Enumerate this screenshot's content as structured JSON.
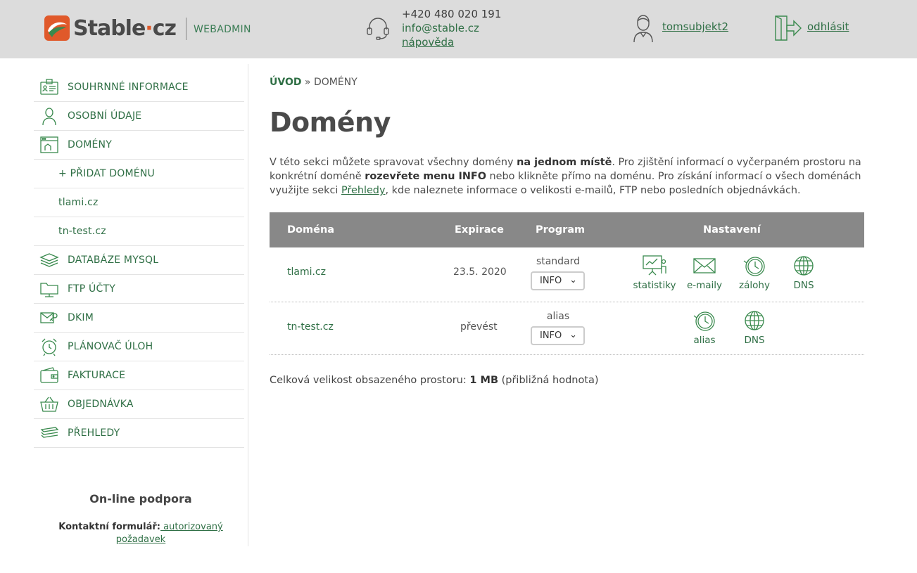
{
  "header": {
    "brand": "Stable",
    "brand_dot": "·",
    "brand_tld": "cz",
    "webadmin": "WEBADMIN",
    "phone": "+420 480 020 191",
    "email": "info@stable.cz",
    "help": "nápověda",
    "username": "tomsubjekt2",
    "logout": "odhlásit"
  },
  "sidebar": {
    "items": [
      {
        "label": "SOUHRNNÉ INFORMACE",
        "icon": "id-card-icon"
      },
      {
        "label": "OSOBNÍ ÚDAJE",
        "icon": "person-icon"
      },
      {
        "label": "DOMÉNY",
        "icon": "browser-window-icon"
      },
      {
        "label": "+ PŘIDAT DOMÉNU"
      },
      {
        "label": "tlami.cz"
      },
      {
        "label": "tn-test.cz"
      },
      {
        "label": "DATABÁZE MYSQL",
        "icon": "database-stack-icon"
      },
      {
        "label": "FTP ÚČTY",
        "icon": "folder-network-icon"
      },
      {
        "label": "DKIM",
        "icon": "key-envelope-icon"
      },
      {
        "label": "PLÁNOVAČ ÚLOH",
        "icon": "alarm-clock-icon"
      },
      {
        "label": "FAKTURACE",
        "icon": "wallet-icon"
      },
      {
        "label": "OBJEDNÁVKA",
        "icon": "basket-icon"
      },
      {
        "label": "PŘEHLEDY",
        "icon": "layers-icon"
      }
    ],
    "support_title": "On-line podpora",
    "support_label": "Kontaktní formulář:",
    "support_link": " autorizovaný požadavek"
  },
  "main": {
    "breadcrumb_home": "ÚVOD",
    "breadcrumb_sep": " » ",
    "breadcrumb_current": "DOMÉNY",
    "title": "Domény",
    "intro": {
      "p1": "V této sekci můžete spravovat všechny domény ",
      "b1": "na jednom místě",
      "p2": ". Pro zjištění informací o vyčerpaném prostoru na konkrétní doméně ",
      "b2": "rozevřete menu INFO",
      "p3": " nebo klikněte přímo na doménu. Pro získání informací o všech doménách využijte sekci ",
      "link": "Přehledy",
      "p4": ", kde naleznete informace o velikosti e-mailů, FTP nebo posledních objednávkách."
    },
    "table": {
      "headers": [
        "Doména",
        "Expirace",
        "Program",
        "Nastavení"
      ],
      "rows": [
        {
          "domain": "tlami.cz",
          "expiration": "23.5. 2020",
          "program": "standard",
          "info_button": "INFO",
          "actions": [
            {
              "label": "statistiky",
              "icon": "presentation-chart-icon"
            },
            {
              "label": "e-maily",
              "icon": "envelope-icon"
            },
            {
              "label": "zálohy",
              "icon": "history-clock-icon"
            },
            {
              "label": "DNS",
              "icon": "globe-icon"
            }
          ]
        },
        {
          "domain": "tn-test.cz",
          "expiration": "převést",
          "program": "alias",
          "info_button": "INFO",
          "actions": [
            {
              "label": "alias",
              "icon": "history-clock-icon"
            },
            {
              "label": "DNS",
              "icon": "globe-icon"
            }
          ]
        }
      ]
    },
    "total_label": "Celková velikost obsazeného prostoru: ",
    "total_value": "1 MB",
    "total_note": " (přibližná hodnota)"
  },
  "colors": {
    "header_bg": "#dcdcdc",
    "brand_green": "#2f6f45",
    "brand_orange": "#e0592a",
    "table_header_bg": "#888888"
  }
}
